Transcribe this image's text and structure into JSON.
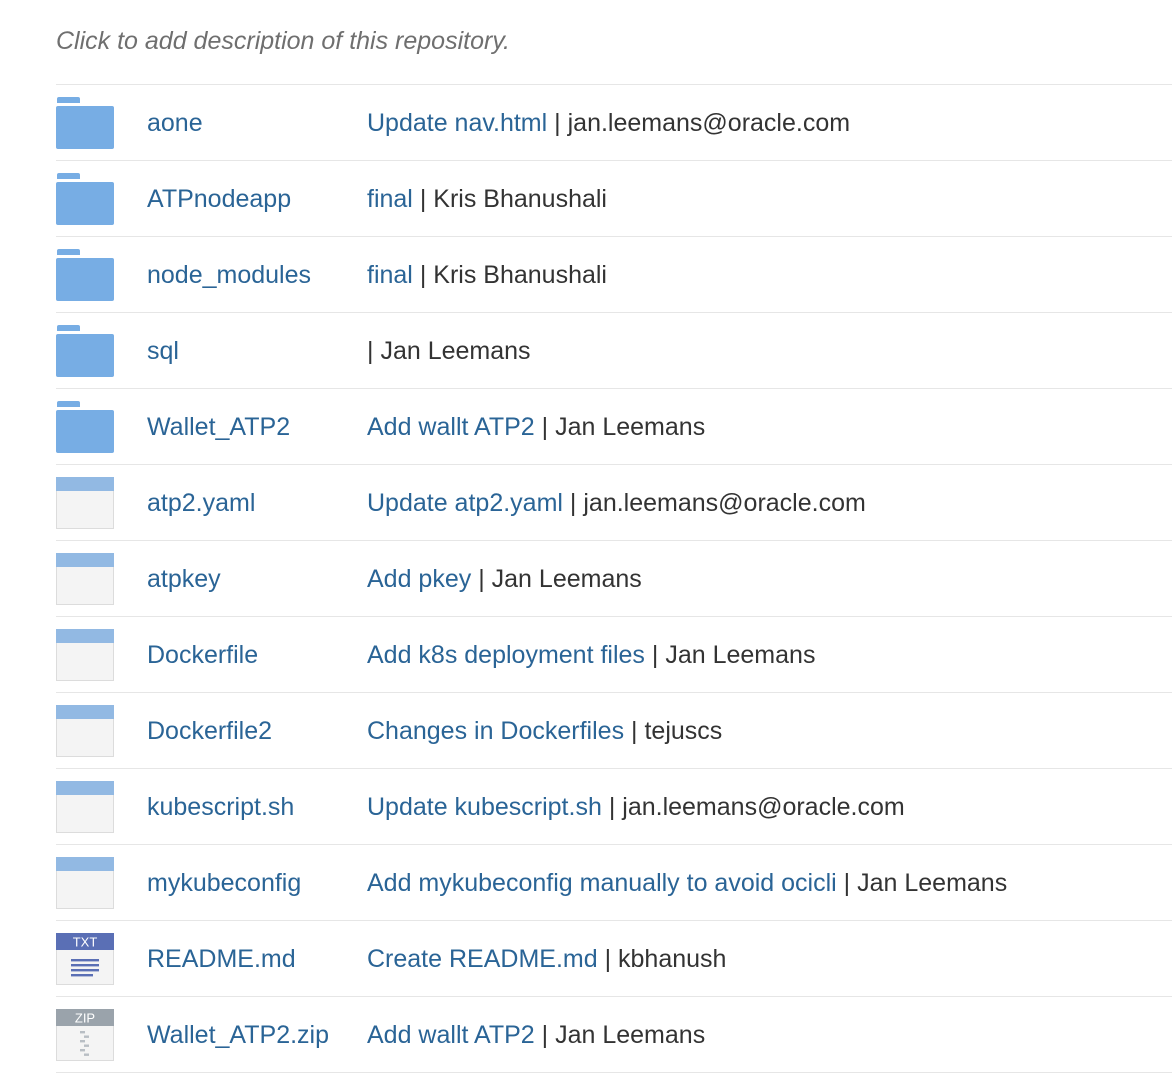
{
  "repository": {
    "description_placeholder": "Click to add description of this repository."
  },
  "colors": {
    "link": "#2a6496",
    "folder": "#77ade4",
    "text": "#333333",
    "muted": "#6f6f6f",
    "txt_badge": "#5a6fb5",
    "zip_badge": "#9aa3ab"
  },
  "separator": "|",
  "files": [
    {
      "icon": "folder-icon",
      "name": "aone",
      "message": "Update nav.html",
      "author": "jan.leemans@oracle.com"
    },
    {
      "icon": "folder-icon",
      "name": "ATPnodeapp",
      "message": "final",
      "author": "Kris Bhanushali"
    },
    {
      "icon": "folder-icon",
      "name": "node_modules",
      "message": "final",
      "author": "Kris Bhanushali"
    },
    {
      "icon": "folder-icon",
      "name": "sql",
      "message": "",
      "author": "Jan Leemans"
    },
    {
      "icon": "folder-icon",
      "name": "Wallet_ATP2",
      "message": "Add wallt ATP2",
      "author": "Jan Leemans"
    },
    {
      "icon": "file-icon",
      "name": "atp2.yaml",
      "message": "Update atp2.yaml",
      "author": "jan.leemans@oracle.com"
    },
    {
      "icon": "file-icon",
      "name": "atpkey",
      "message": "Add pkey",
      "author": "Jan Leemans"
    },
    {
      "icon": "file-icon",
      "name": "Dockerfile",
      "message": "Add k8s deployment files",
      "author": "Jan Leemans"
    },
    {
      "icon": "file-icon",
      "name": "Dockerfile2",
      "message": "Changes in Dockerfiles",
      "author": "tejuscs"
    },
    {
      "icon": "file-icon",
      "name": "kubescript.sh",
      "message": "Update kubescript.sh",
      "author": "jan.leemans@oracle.com"
    },
    {
      "icon": "file-icon",
      "name": "mykubeconfig",
      "message": "Add mykubeconfig manually to avoid ocicli",
      "author": "Jan Leemans"
    },
    {
      "icon": "txt-file-icon",
      "badge": "TXT",
      "name": "README.md",
      "message": "Create README.md",
      "author": "kbhanush"
    },
    {
      "icon": "zip-file-icon",
      "badge": "ZIP",
      "name": "Wallet_ATP2.zip",
      "message": "Add wallt ATP2",
      "author": "Jan Leemans"
    }
  ]
}
